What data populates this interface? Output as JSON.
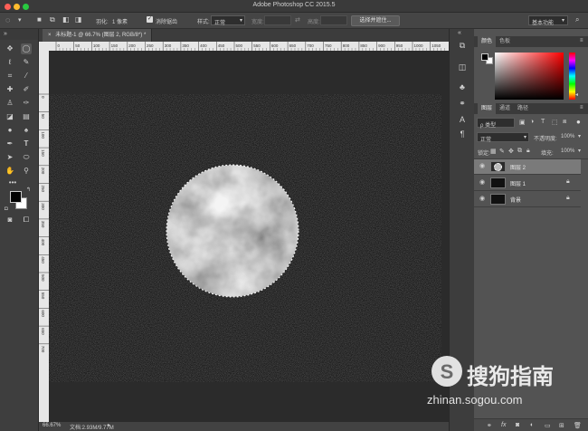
{
  "window": {
    "title": "Adobe Photoshop CC 2015.5"
  },
  "options_bar": {
    "feather_label": "羽化:",
    "feather_value": "1 像素",
    "antialias_label": "消除锯齿",
    "style_label": "样式:",
    "style_value": "正常",
    "width_label": "宽度:",
    "height_label": "高度:",
    "select_mask_button": "选择并遮住...",
    "workspace_value": "基本功能"
  },
  "document": {
    "tab_title": "未标题-1 @ 66.7% (图层 2, RGB/8*) *"
  },
  "status_bar": {
    "zoom": "66.67%",
    "doc_info": "文档:2.93M/9.77M"
  },
  "color_panel": {
    "tabs": [
      "颜色",
      "色板"
    ]
  },
  "layers_panel": {
    "tabs": [
      "图层",
      "通道",
      "路径"
    ],
    "filter_kind": "ρ 类型",
    "blend_mode": "正常",
    "opacity_label": "不透明度:",
    "opacity_value": "100%",
    "lock_label": "锁定:",
    "fill_label": "填充:",
    "fill_value": "100%",
    "layers": [
      {
        "name": "图层 2",
        "selected": true,
        "locked": false
      },
      {
        "name": "图层 1",
        "selected": false,
        "locked": true
      },
      {
        "name": "背景",
        "selected": false,
        "locked": true
      }
    ],
    "footer_icons": [
      "link-icon",
      "fx-icon",
      "mask-icon",
      "adjustment-icon",
      "folder-icon",
      "new-layer-icon",
      "trash-icon"
    ]
  },
  "ruler": {
    "h_ticks": [
      "0",
      "50",
      "100",
      "150",
      "200",
      "250",
      "300",
      "350",
      "400",
      "450",
      "500",
      "550",
      "600",
      "650",
      "700",
      "750",
      "800",
      "850",
      "900",
      "950",
      "1000",
      "1050",
      "1100"
    ],
    "v_ticks": [
      "0",
      "50",
      "100",
      "150",
      "200",
      "250",
      "300",
      "350",
      "400",
      "450",
      "500",
      "550",
      "600",
      "650",
      "700"
    ]
  },
  "watermark": {
    "brand": "搜狗指南",
    "url": "zhinan.sogou.com"
  }
}
